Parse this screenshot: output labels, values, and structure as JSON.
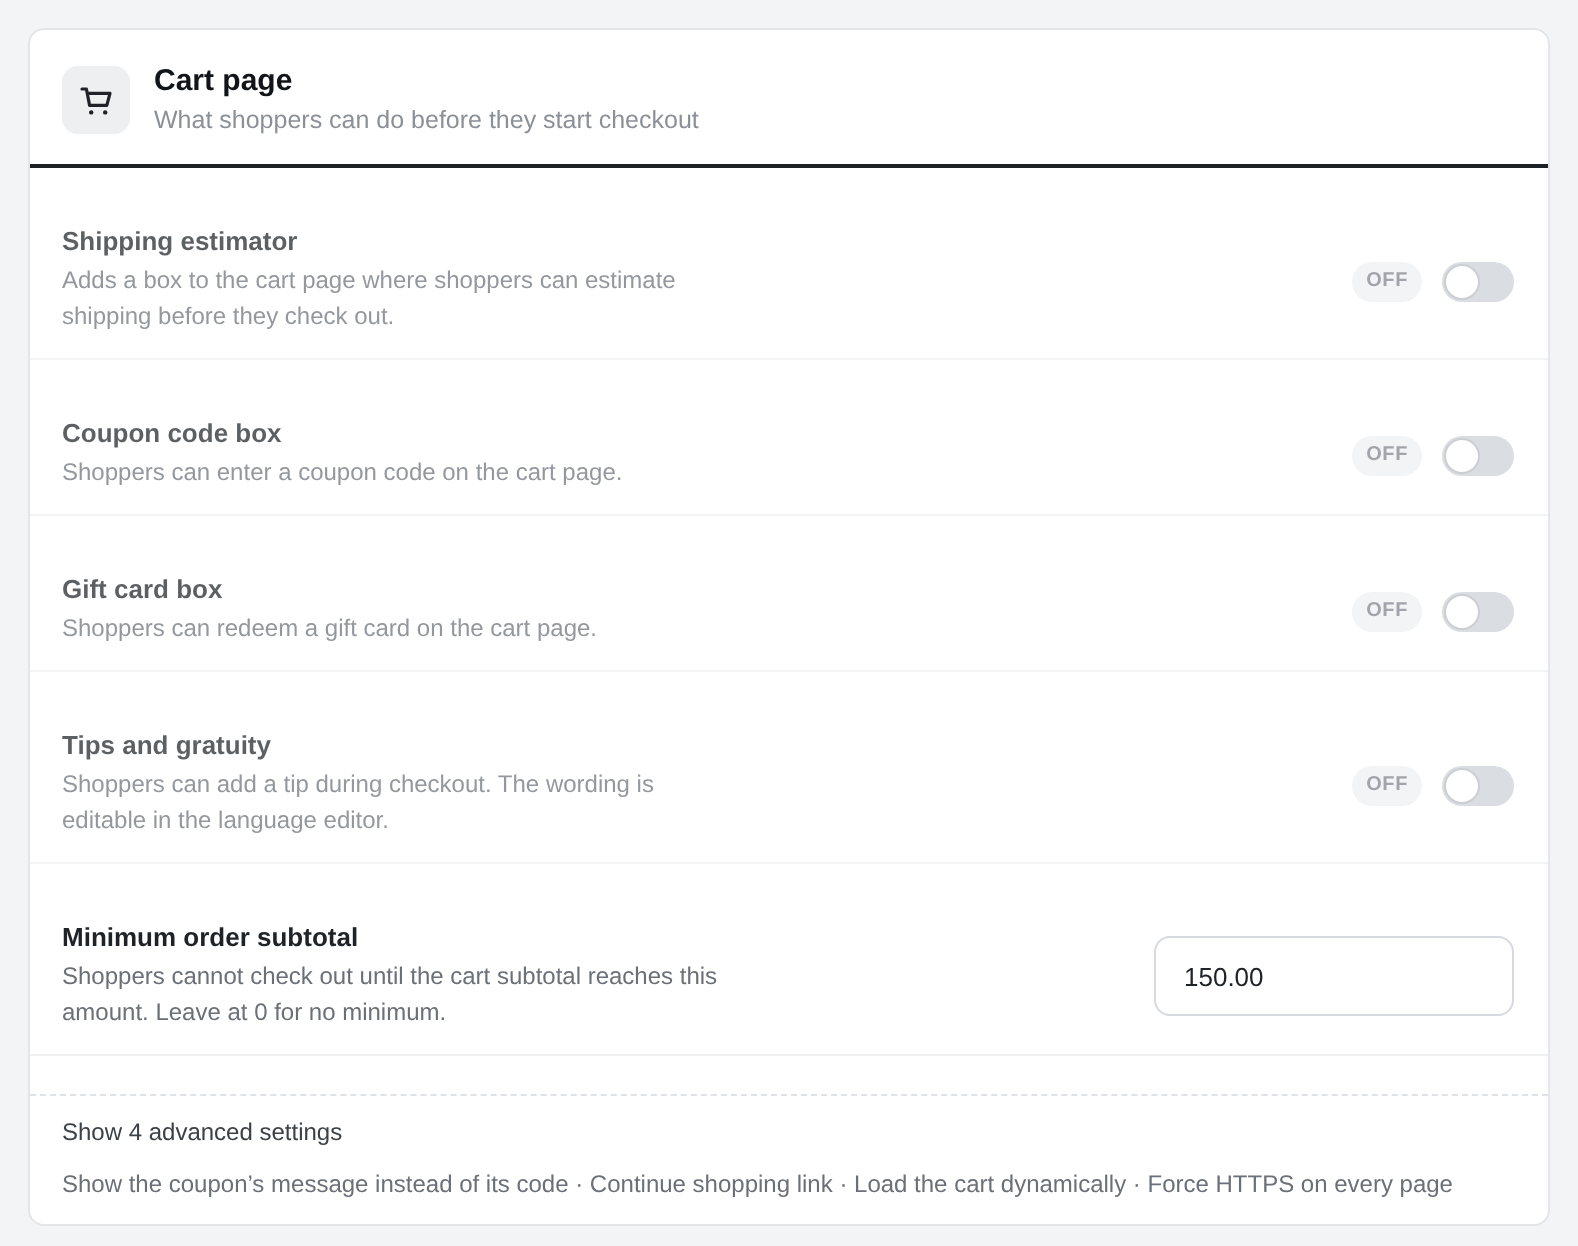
{
  "header": {
    "title": "Cart page",
    "subtitle": "What shoppers can do before they start checkout"
  },
  "settings": [
    {
      "kind": "toggle",
      "title": "Shipping estimator",
      "description": "Adds a box to the cart page where shoppers can estimate shipping before they check out.",
      "disabled": true,
      "state_label": "OFF",
      "on": false
    },
    {
      "kind": "toggle",
      "title": "Coupon code box",
      "description": "Shoppers can enter a coupon code on the cart page.",
      "disabled": true,
      "state_label": "OFF",
      "on": false
    },
    {
      "kind": "toggle",
      "title": "Gift card box",
      "description": "Shoppers can redeem a gift card on the cart page.",
      "disabled": true,
      "state_label": "OFF",
      "on": false
    },
    {
      "kind": "toggle",
      "title": "Tips and gratuity",
      "description": "Shoppers can add a tip during checkout. The wording is editable in the language editor.",
      "disabled": true,
      "state_label": "OFF",
      "on": false
    },
    {
      "kind": "input",
      "title": "Minimum order subtotal",
      "description": "Shoppers cannot check out until the cart subtotal reaches this amount. Leave at 0 for no minimum.",
      "disabled": false,
      "value": "150.00"
    }
  ],
  "advanced": {
    "toggle_label": "Show 4 advanced settings",
    "summary": "Show the coupon’s message instead of its code · Continue shopping link · Load the cart dynamically · Force HTTPS on every page"
  }
}
